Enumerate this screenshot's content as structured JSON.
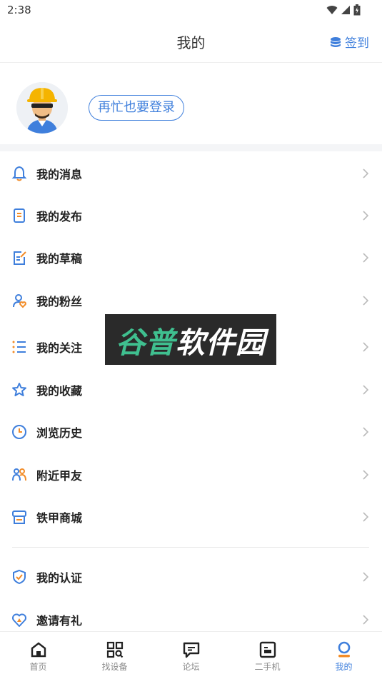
{
  "status_bar": {
    "time": "2:38"
  },
  "header": {
    "title": "我的",
    "checkin_label": "签到"
  },
  "profile": {
    "login_label": "再忙也要登录"
  },
  "menu": [
    {
      "key": "messages",
      "label": "我的消息",
      "icon": "bell-icon"
    },
    {
      "key": "posts",
      "label": "我的发布",
      "icon": "document-icon"
    },
    {
      "key": "drafts",
      "label": "我的草稿",
      "icon": "edit-icon"
    },
    {
      "key": "fans",
      "label": "我的粉丝",
      "icon": "user-heart-icon"
    },
    {
      "key": "following",
      "label": "我的关注",
      "icon": "list-icon"
    },
    {
      "key": "favorites",
      "label": "我的收藏",
      "icon": "star-icon"
    },
    {
      "key": "history",
      "label": "浏览历史",
      "icon": "clock-icon"
    },
    {
      "key": "nearby",
      "label": "附近甲友",
      "icon": "people-icon"
    },
    {
      "key": "mall",
      "label": "铁甲商城",
      "icon": "store-icon"
    },
    {
      "key": "certification",
      "label": "我的认证",
      "icon": "shield-check-icon"
    },
    {
      "key": "invite",
      "label": "邀请有礼",
      "icon": "heart-icon"
    }
  ],
  "watermark": {
    "part1": "谷普",
    "part2": "软件园"
  },
  "bottom_nav": [
    {
      "label": "首页",
      "icon": "home-icon",
      "active": false
    },
    {
      "label": "找设备",
      "icon": "grid-search-icon",
      "active": false
    },
    {
      "label": "论坛",
      "icon": "chat-icon",
      "active": false
    },
    {
      "label": "二手机",
      "icon": "machine-card-icon",
      "active": false
    },
    {
      "label": "我的",
      "icon": "profile-icon",
      "active": true
    }
  ],
  "colors": {
    "accent": "#3f7fdc",
    "text": "#222222",
    "muted": "#888888",
    "band": "#f4f5f7"
  }
}
